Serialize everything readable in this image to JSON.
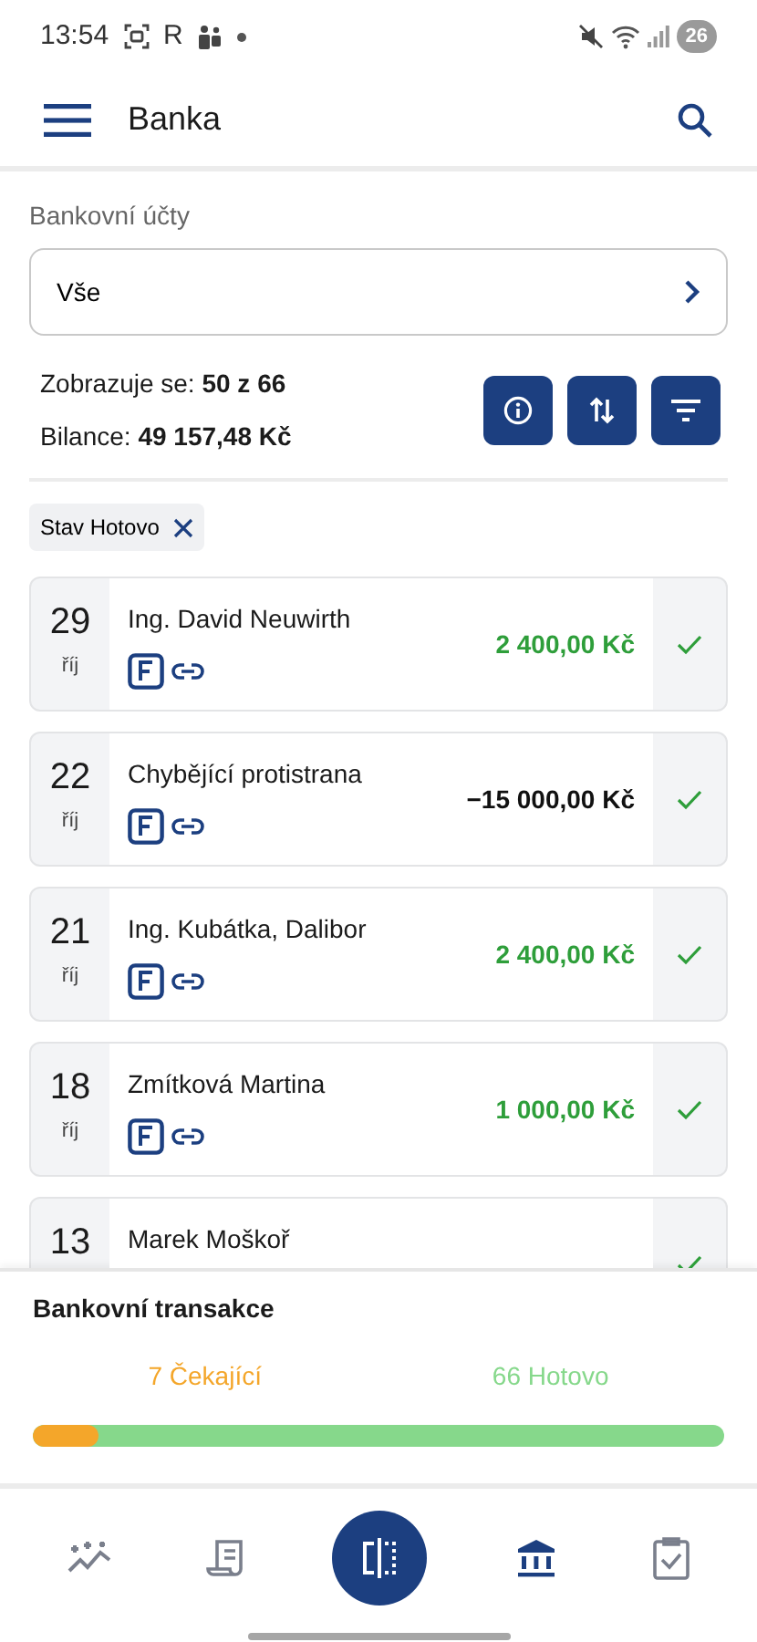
{
  "status_bar": {
    "time": "13:54",
    "app_letter": "R",
    "battery": "26"
  },
  "header": {
    "title": "Banka"
  },
  "account_select": {
    "label": "Bankovní účty",
    "value": "Vše"
  },
  "summary": {
    "shown_label": "Zobrazuje se:",
    "shown_value": "50 z 66",
    "balance_label": "Bilance:",
    "balance_value": "49 157,48 Kč"
  },
  "filters": [
    {
      "label": "Stav Hotovo"
    }
  ],
  "transactions": [
    {
      "day": "29",
      "month": "říj",
      "name": "Ing. David Neuwirth",
      "amount": "2 400,00 Kč",
      "kind": "credit",
      "done": true
    },
    {
      "day": "22",
      "month": "říj",
      "name": "Chybějící protistrana",
      "amount": "−15 000,00 Kč",
      "kind": "debit",
      "done": true
    },
    {
      "day": "21",
      "month": "říj",
      "name": "Ing. Kubátka, Dalibor",
      "amount": "2 400,00 Kč",
      "kind": "credit",
      "done": true
    },
    {
      "day": "18",
      "month": "říj",
      "name": "Zmítková Martina",
      "amount": "1 000,00 Kč",
      "kind": "credit",
      "done": true
    },
    {
      "day": "13",
      "name": "Marek Moškoř",
      "done": true
    }
  ],
  "bottom_sheet": {
    "title": "Bankovní transakce",
    "pending": "7 Čekající",
    "done": "66 Hotovo",
    "level": 0.096
  },
  "nav": [
    {
      "kind": "insights",
      "selected": false
    },
    {
      "kind": "receipt",
      "selected": false
    },
    {
      "kind": "split",
      "selected": false
    },
    {
      "kind": "bank",
      "selected": true
    },
    {
      "kind": "tasks",
      "selected": false
    }
  ]
}
